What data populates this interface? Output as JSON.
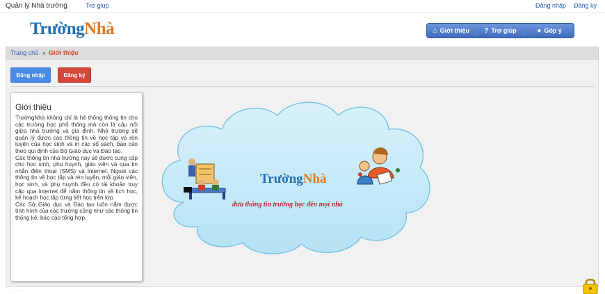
{
  "topbar": {
    "brand": "Quản lý Nhà trường",
    "help": "Trợ giúp",
    "login": "Đăng nhập",
    "register": "Đăng ký"
  },
  "logo": {
    "part1": "Trường",
    "part2": "Nhà"
  },
  "nav": [
    {
      "label": "Giới thiệu",
      "icon": "home-icon"
    },
    {
      "label": "Trợ giúp",
      "icon": "question-icon"
    },
    {
      "label": "Góp ý",
      "icon": "chat-bubble-icon"
    }
  ],
  "breadcrumb": {
    "home": "Trang chủ",
    "separator": "»",
    "current": "Giới thiệu"
  },
  "actions": {
    "login": "Đăng nhập",
    "register": "Đăng ký"
  },
  "intro": {
    "title": "Giới thiệu",
    "paragraphs": [
      "TrườngNhà không chỉ là hệ thống thông tin cho các trường học phổ thông mà còn là cầu nối giữa nhà trường và gia đình. Nhà trường sẽ quản lý được các thông tin về học tập và rèn luyện của học sinh và in các sổ sách, báo cáo theo qui định của Bộ Giáo dục và Đào tạo.",
      "Các thông tin nhà trường này sẽ được cung cấp cho học sinh, phụ huynh, giáo viên và qua tin nhắn điện thoại (SMS) và internet. Ngoài các thông tin về học tập và rèn luyện, mỗi giáo viên, học sinh, và phụ huynh đều có tài khoản truy cập qua internet để nắm thông tin về lịch học, kế hoạch học tập từng tiết học trên lớp.",
      "Các Sở Giáo dục và Đào tạo luôn nắm được tình hình của các trường cũng như các thông tin thống kê, báo cáo tổng hợp."
    ]
  },
  "banner": {
    "brand1": "Trường",
    "brand2": "Nhà",
    "slogan": "đưa thông tin trường học đến mọi nhà"
  },
  "colors": {
    "accent_blue": "#1f6fb2",
    "accent_orange": "#e07b24",
    "nav_blue": "#4a78c8",
    "register_red": "#d3483a",
    "breadcrumb_current": "#d24726",
    "slogan_red": "#c0282d"
  }
}
